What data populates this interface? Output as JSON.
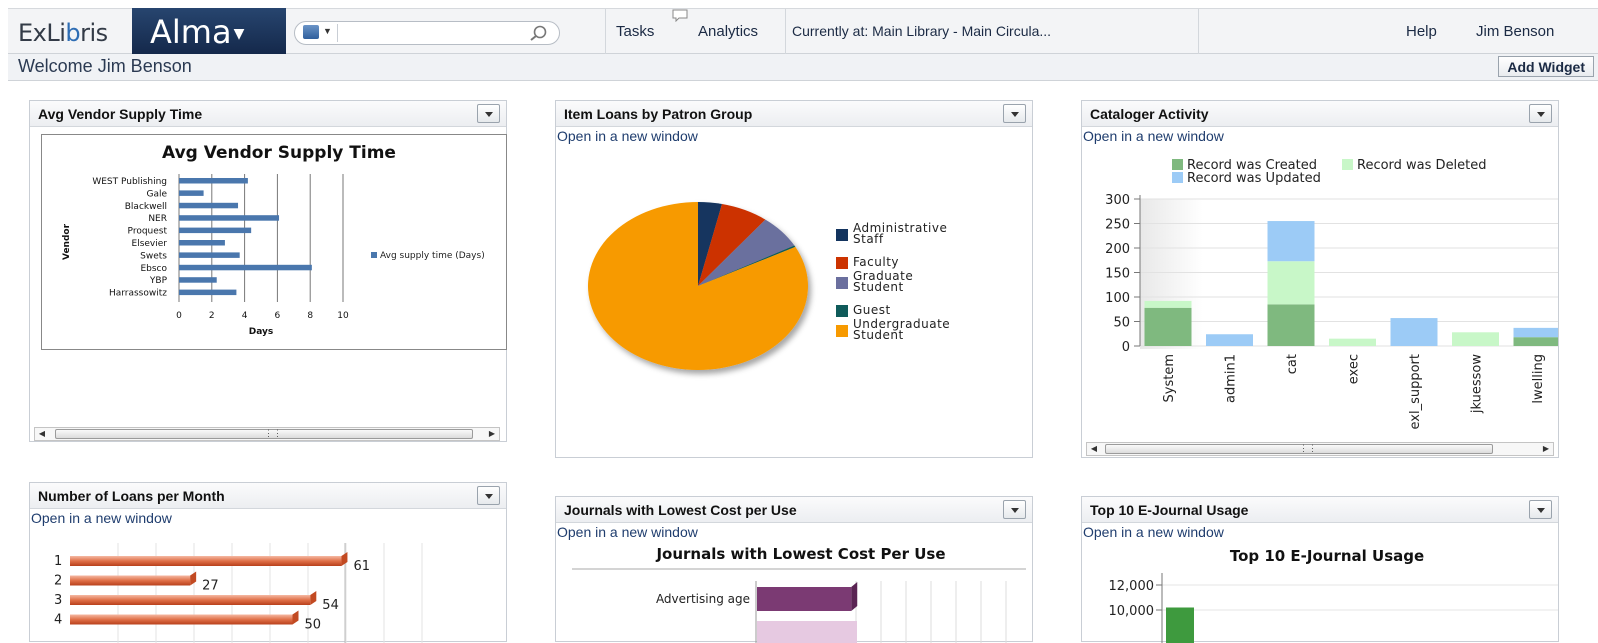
{
  "header": {
    "logo_text": "ExLibris",
    "app_name": "Alma",
    "search_placeholder": "",
    "tasks": "Tasks",
    "analytics": "Analytics",
    "location": "Currently at: Main Library - Main Circula...",
    "help": "Help",
    "user": "Jim Benson"
  },
  "welcome": {
    "text": "Welcome Jim Benson",
    "add_widget": "Add Widget"
  },
  "widgets": {
    "vendor": {
      "title": "Avg Vendor Supply Time"
    },
    "patron": {
      "title": "Item Loans by Patron Group",
      "link": "Open in a new window"
    },
    "cataloger": {
      "title": "Cataloger Activity",
      "link": "Open in a new window"
    },
    "loans": {
      "title": "Number of Loans per Month",
      "link": "Open in a new window"
    },
    "journals": {
      "title": "Journals with Lowest Cost per Use",
      "link": "Open in a new window"
    },
    "ejournal": {
      "title": "Top 10 E-Journal Usage",
      "link": "Open in a new window"
    }
  },
  "colors": {
    "accent": "#1f3d6e",
    "brand": "#1b355e"
  },
  "chart_data": [
    {
      "id": "vendor",
      "type": "bar",
      "orientation": "horizontal",
      "title": "Avg Vendor Supply Time",
      "xlabel": "Days",
      "ylabel": "Vendor",
      "categories": [
        "WEST Publishing",
        "Gale",
        "Blackwell",
        "NER",
        "Proquest",
        "Elsevier",
        "Swets",
        "Ebsco",
        "YBP",
        "Harrassowitz"
      ],
      "series": [
        {
          "name": "Avg supply time (Days)",
          "values": [
            4.2,
            1.5,
            3.6,
            6.1,
            4.4,
            2.8,
            3.7,
            8.1,
            2.3,
            3.5
          ],
          "color": "#4a77ad"
        }
      ],
      "xlim": [
        0,
        10
      ],
      "xticks": [
        "0",
        "2",
        "4",
        "6",
        "8",
        "10"
      ],
      "grid": true,
      "legend": "right"
    },
    {
      "id": "patron",
      "type": "pie",
      "categories": [
        "Administrative Staff",
        "Faculty",
        "Graduate Student",
        "Guest",
        "Undergraduate Student"
      ],
      "values": [
        3.5,
        7,
        6.5,
        0.3,
        82.7
      ],
      "colors": [
        "#13345e",
        "#cc3300",
        "#6b6f9e",
        "#0f5b5a",
        "#f79a00"
      ],
      "legend": "right"
    },
    {
      "id": "cataloger",
      "type": "bar",
      "stacked": true,
      "categories": [
        "System",
        "admin1",
        "cat",
        "exec",
        "exl_support",
        "jkuessow",
        "lwelling"
      ],
      "series": [
        {
          "name": "Record was Created",
          "values": [
            78,
            0,
            85,
            0,
            0,
            0,
            18
          ],
          "color": "#7fb97f"
        },
        {
          "name": "Record was Deleted",
          "values": [
            14,
            0,
            88,
            15,
            0,
            28,
            0
          ],
          "color": "#c8f7c8"
        },
        {
          "name": "Record was Updated",
          "values": [
            0,
            24,
            82,
            0,
            57,
            0,
            19
          ],
          "color": "#9ccbf6"
        }
      ],
      "ylim": [
        0,
        300
      ],
      "yticks": [
        "0",
        "50",
        "100",
        "150",
        "200",
        "250",
        "300"
      ],
      "legend": "top"
    },
    {
      "id": "loans",
      "type": "bar",
      "orientation": "horizontal",
      "categories": [
        "1",
        "2",
        "3",
        "4"
      ],
      "values": [
        61,
        27,
        54,
        50
      ],
      "data_labels": [
        "61",
        "27",
        "54",
        "50"
      ],
      "color": "#d35a2a"
    },
    {
      "id": "journals",
      "type": "bar",
      "orientation": "horizontal",
      "title": "Journals with Lowest Cost Per Use",
      "categories": [
        "Advertising age"
      ],
      "values": [
        0.65
      ],
      "color": "#7b3a73"
    },
    {
      "id": "ejournal",
      "type": "bar",
      "title": "Top 10 E-Journal Usage",
      "yticks": [
        "12,000",
        "10,000"
      ],
      "categories": [
        ""
      ],
      "values": [
        10200
      ],
      "color": "#3e9a3e"
    }
  ]
}
